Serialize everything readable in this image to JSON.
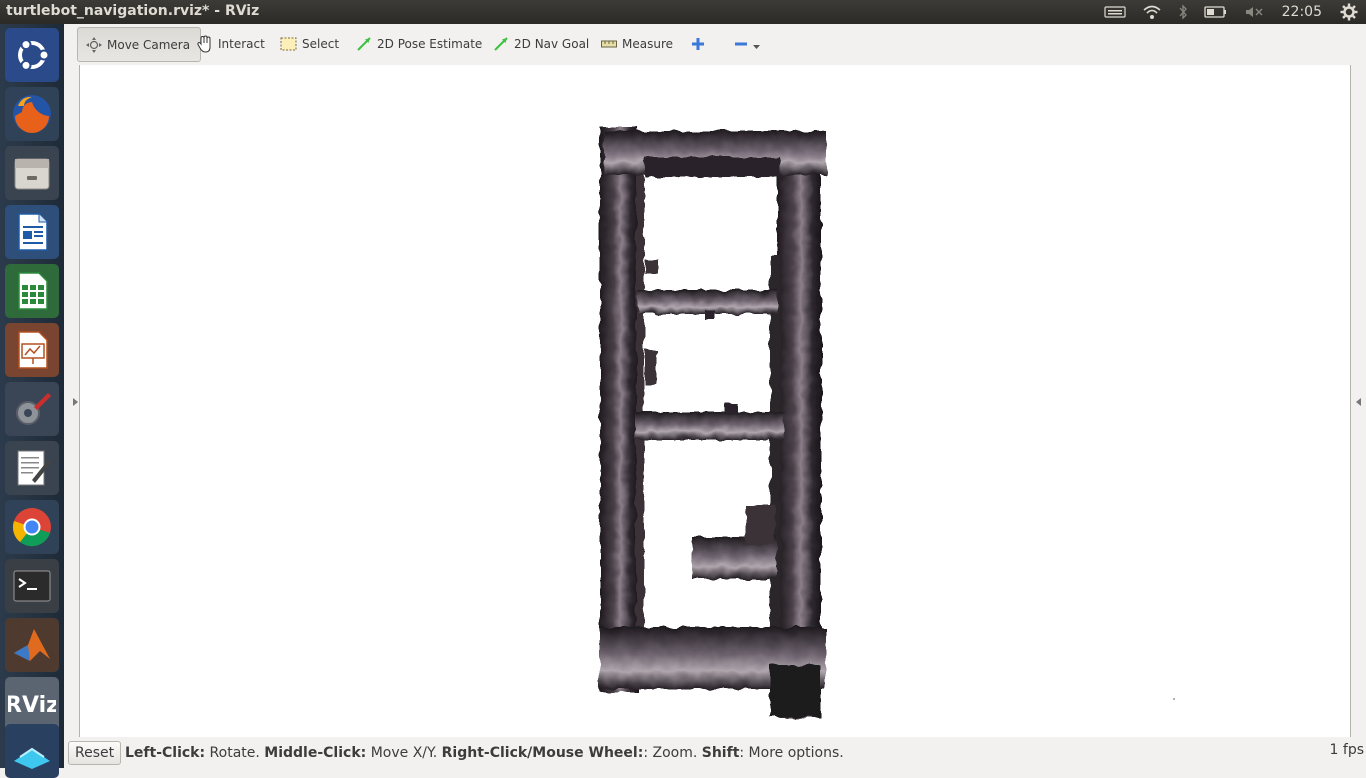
{
  "window": {
    "title": "turtlebot_navigation.rviz* - RViz"
  },
  "tray": {
    "clock": "22:05"
  },
  "launcher": {
    "items": [
      {
        "name": "ubuntu-dash-icon"
      },
      {
        "name": "firefox-icon"
      },
      {
        "name": "files-icon"
      },
      {
        "name": "writer-icon"
      },
      {
        "name": "calc-icon"
      },
      {
        "name": "impress-icon"
      },
      {
        "name": "system-settings-icon"
      },
      {
        "name": "text-editor-icon"
      },
      {
        "name": "chrome-icon"
      },
      {
        "name": "terminal-icon"
      },
      {
        "name": "matlab-icon"
      },
      {
        "name": "rviz-icon",
        "label": "RViz"
      },
      {
        "name": "workspace-icon"
      }
    ]
  },
  "toolbar": {
    "move_camera": "Move Camera",
    "interact": "Interact",
    "select": "Select",
    "pose_estimate": "2D Pose Estimate",
    "nav_goal": "2D Nav Goal",
    "measure": "Measure"
  },
  "status": {
    "reset": "Reset",
    "h1": "Left-Click:",
    "t1": " Rotate. ",
    "h2": "Middle-Click:",
    "t2": " Move X/Y. ",
    "h3": "Right-Click/Mouse Wheel:",
    "t3": ": Zoom. ",
    "h4": "Shift",
    "t4": ": More options.",
    "fps": "1 fps"
  },
  "colors": {
    "topbar": "#3c3b37",
    "launcher": "#2c3b4c",
    "map_dark": "#1e1a1e",
    "map_light": "#8c7f8a",
    "tool_green": "#3ec13e",
    "tool_blue": "#3b78d8"
  }
}
